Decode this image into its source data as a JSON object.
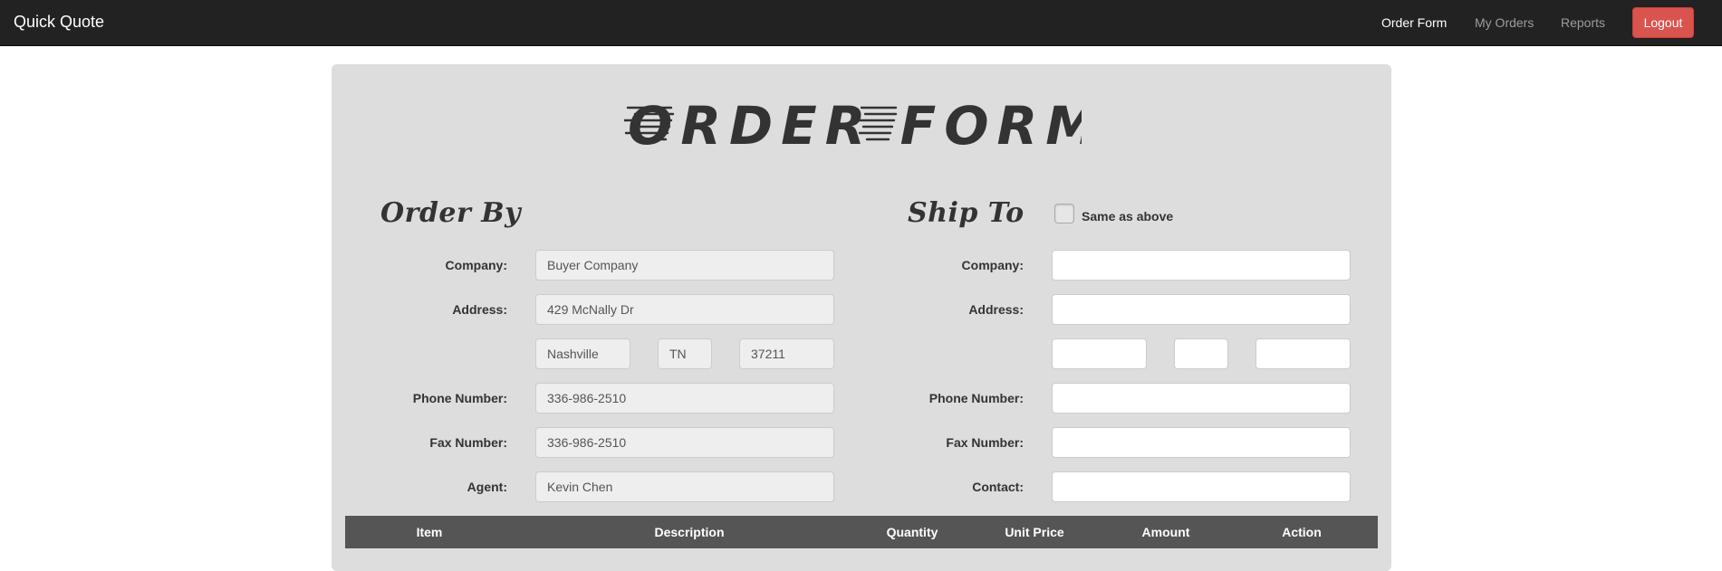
{
  "navbar": {
    "brand": "Quick Quote",
    "links": [
      "Order Form",
      "My Orders",
      "Reports"
    ],
    "logout_label": "Logout"
  },
  "logo": {
    "text": "ORDER FORM",
    "style": "speed-lines italic logo"
  },
  "order_by": {
    "title": "Order By",
    "labels": {
      "company": "Company:",
      "address": "Address:",
      "phone": "Phone Number:",
      "fax": "Fax Number:",
      "agent": "Agent:"
    },
    "values": {
      "company": "Buyer Company",
      "address": "429 McNally Dr",
      "city": "Nashville",
      "state": "TN",
      "zip": "37211",
      "phone": "336-986-2510",
      "fax": "336-986-2510",
      "agent": "Kevin Chen"
    }
  },
  "ship_to": {
    "title": "Ship To",
    "same_as_above_label": "Same as above",
    "same_as_above_checked": false,
    "labels": {
      "company": "Company:",
      "address": "Address:",
      "phone": "Phone Number:",
      "fax": "Fax Number:",
      "contact": "Contact:"
    },
    "values": {
      "company": "",
      "address": "",
      "city": "",
      "state": "",
      "zip": "",
      "phone": "",
      "fax": "",
      "contact": ""
    }
  },
  "table": {
    "headers": [
      "Item",
      "Description",
      "Quantity",
      "Unit Price",
      "Amount",
      "Action"
    ]
  },
  "colors": {
    "navbar_bg": "#222222",
    "panel_bg": "#dddddd",
    "logout_bg": "#d9534f",
    "table_header_bg": "#555555"
  }
}
